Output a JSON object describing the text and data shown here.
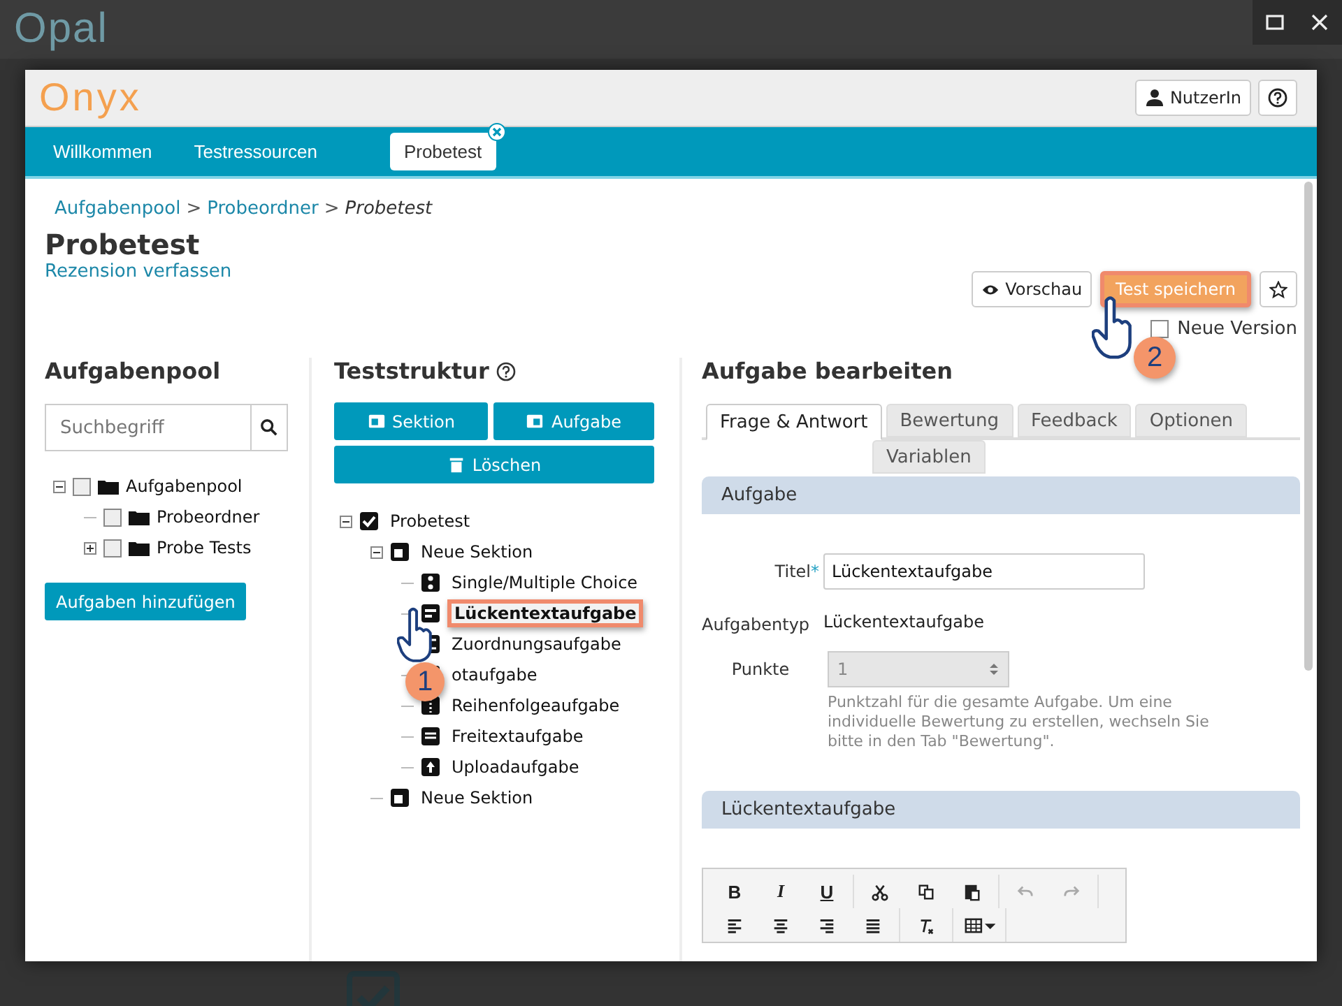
{
  "background": {
    "logo": "Opal"
  },
  "header": {
    "logo": "Onyx",
    "user_button": "NutzerIn"
  },
  "nav": {
    "tabs": [
      {
        "label": "Willkommen",
        "selected": false
      },
      {
        "label": "Testressourcen",
        "selected": false
      },
      {
        "label": "Probetest",
        "selected": true,
        "closable": true
      }
    ]
  },
  "breadcrumb": {
    "separator": ">",
    "items": [
      {
        "label": "Aufgabenpool",
        "current": false
      },
      {
        "label": "Probeordner",
        "current": false
      },
      {
        "label": "Probetest",
        "current": true
      }
    ]
  },
  "page": {
    "title": "Probetest",
    "review_link": "Rezension verfassen"
  },
  "actions": {
    "buttons": [
      {
        "label": "Vorschau",
        "kind": "preview",
        "highlighted": false
      },
      {
        "label": "Test speichern",
        "kind": "save",
        "highlighted": true
      }
    ],
    "new_version": {
      "label": "Neue Version",
      "checked": false
    }
  },
  "pool": {
    "title": "Aufgabenpool",
    "search": {
      "placeholder": "Suchbegriff"
    },
    "tree": [
      {
        "label": "Aufgabenpool",
        "checked": false,
        "expanded": true,
        "children": [
          {
            "label": "Probeordner",
            "checked": false
          },
          {
            "label": "Probe Tests",
            "checked": false,
            "expanded": false
          }
        ]
      }
    ],
    "add_button": "Aufgaben hinzufügen"
  },
  "structure": {
    "title": "Teststruktur",
    "buttons": [
      {
        "label": "Sektion",
        "kind": "section"
      },
      {
        "label": "Aufgabe",
        "kind": "task"
      }
    ],
    "delete_button": "Löschen",
    "tree": [
      {
        "label": "Probetest",
        "kind": "test",
        "selected": false,
        "expanded": true,
        "children": [
          {
            "label": "Neue Sektion",
            "kind": "section",
            "selected": false,
            "expanded": true,
            "children": [
              {
                "label": "Single/Multiple Choice",
                "kind": "choice",
                "selected": false
              },
              {
                "label": "Lückentextaufgabe",
                "kind": "gap",
                "selected": true
              },
              {
                "label": "Zuordnungsaufgabe",
                "kind": "match",
                "selected": false
              },
              {
                "label": "otaufgabe",
                "kind": "hotspot",
                "selected": false
              },
              {
                "label": "Reihenfolgeaufgabe",
                "kind": "order",
                "selected": false
              },
              {
                "label": "Freitextaufgabe",
                "kind": "text",
                "selected": false
              },
              {
                "label": "Uploadaufgabe",
                "kind": "upload",
                "selected": false
              }
            ]
          },
          {
            "label": "Neue Sektion",
            "kind": "section",
            "selected": false
          }
        ]
      }
    ]
  },
  "editor": {
    "title": "Aufgabe bearbeiten",
    "tabs": [
      {
        "label": "Frage & Antwort",
        "selected": true
      },
      {
        "label": "Bewertung",
        "selected": false
      },
      {
        "label": "Feedback",
        "selected": false
      },
      {
        "label": "Optionen",
        "selected": false
      },
      {
        "label": "Variablen",
        "selected": false
      }
    ],
    "section_title": "Aufgabe",
    "fields": [
      {
        "kind": "input",
        "label": "Titel",
        "required_mark": "*",
        "value": "Lückentextaufgabe"
      },
      {
        "kind": "static",
        "label": "Aufgabentyp",
        "value": "Lückentextaufgabe"
      },
      {
        "kind": "spinner",
        "label": "Punkte",
        "value": "1",
        "disabled": true,
        "help": "Punktzahl für die gesamte Aufgabe. Um eine individuelle Bewertung zu erstellen, wechseln Sie bitte in den Tab \"Bewertung\"."
      }
    ],
    "text_section": {
      "title": "Lückentextaufgabe",
      "toolbar": [
        [
          {
            "kind": "bold",
            "label": "B",
            "disabled": false
          },
          {
            "kind": "italic",
            "label": "I",
            "disabled": false
          },
          {
            "kind": "underline",
            "label": "U",
            "disabled": false
          }
        ],
        [
          {
            "kind": "cut",
            "disabled": false
          },
          {
            "kind": "copy",
            "disabled": false
          },
          {
            "kind": "paste",
            "disabled": false
          }
        ],
        [
          {
            "kind": "undo",
            "disabled": true
          },
          {
            "kind": "redo",
            "disabled": true
          }
        ],
        [
          {
            "kind": "align-left",
            "disabled": false
          },
          {
            "kind": "align-center",
            "disabled": false
          },
          {
            "kind": "align-right",
            "disabled": false
          },
          {
            "kind": "justify",
            "disabled": false
          }
        ],
        [
          {
            "kind": "clear-format",
            "disabled": false
          }
        ],
        [
          {
            "kind": "table",
            "disabled": false
          }
        ]
      ]
    }
  },
  "annotations": [
    {
      "number": "1"
    },
    {
      "number": "2"
    }
  ]
}
